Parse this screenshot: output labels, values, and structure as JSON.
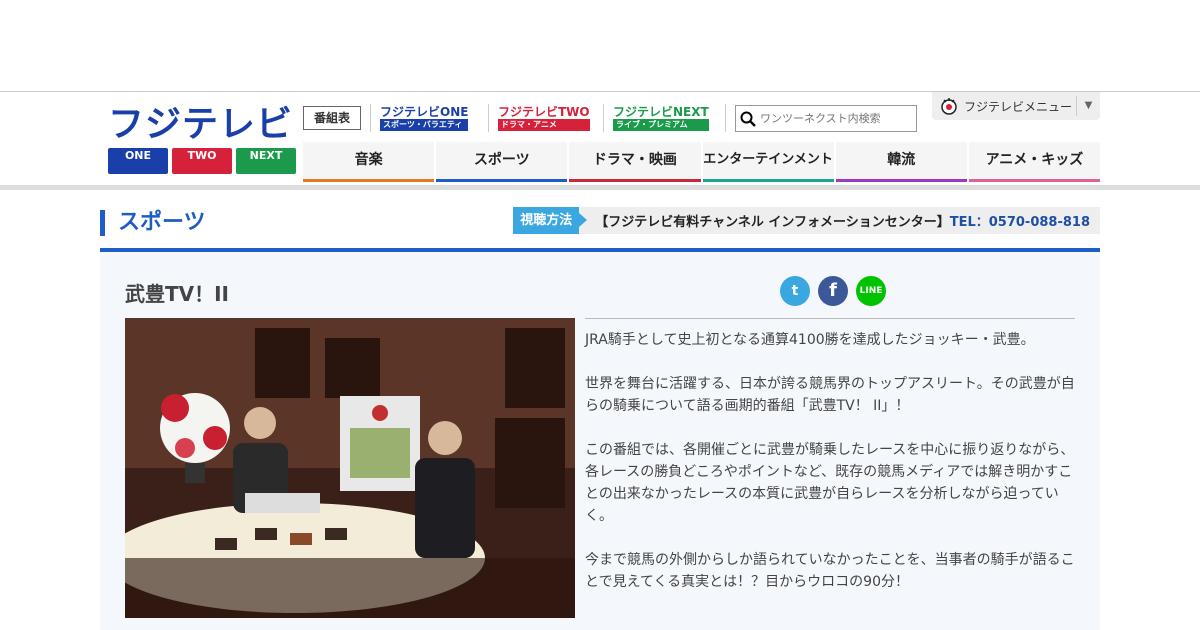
{
  "header": {
    "logo": {
      "main": "フジテレビ",
      "one": "ONE",
      "two": "TWO",
      "next": "NEXT"
    },
    "tv_guide": "番組表",
    "channels": [
      {
        "name": "フジテレビONE",
        "sub": "スポーツ・バラエティ",
        "color": "#1a3fa8"
      },
      {
        "name": "フジテレビTWO",
        "sub": "ドラマ・アニメ",
        "color": "#d6213a"
      },
      {
        "name": "フジテレビNEXT",
        "sub": "ライブ・プレミアム",
        "color": "#1a9a4a"
      }
    ],
    "search_placeholder": "ワンツーネクスト内検索",
    "fuji_menu": "フジテレビメニュー"
  },
  "nav": [
    {
      "label": "音楽",
      "color": "#e07a2a"
    },
    {
      "label": "スポーツ",
      "color": "#1e5cc8"
    },
    {
      "label": "ドラマ・映画",
      "color": "#c8283c"
    },
    {
      "label": "エンターテインメント",
      "color": "#1aa58a"
    },
    {
      "label": "韓流",
      "color": "#9a3cc0"
    },
    {
      "label": "アニメ・キッズ",
      "color": "#e0609a"
    }
  ],
  "section": {
    "title": "スポーツ",
    "badge": "視聴方法",
    "info": "【フジテレビ有料チャンネル インフォメーションセンター】",
    "tel": "TEL：0570-088-818"
  },
  "program": {
    "title": "武豊TV！II",
    "description": [
      "JRA騎手として史上初となる通算4100勝を達成したジョッキー・武豊。",
      "世界を舞台に活躍する、日本が誇る競馬界のトップアスリート。その武豊が自らの騎乗について語る画期的番組「武豊TV！ II」！",
      "この番組では、各開催ごとに武豊が騎乗したレースを中心に振り返りながら、各レースの勝負どころやポイントなど、既存の競馬メディアでは解き明かすことの出来なかったレースの本質に武豊が自らレースを分析しながら迫っていく。",
      "今まで競馬の外側からしか語られていなかったことを、当事者の騎手が語ることで見えてくる真実とは！？目からウロコの90分！"
    ]
  },
  "share": [
    {
      "name": "twitter",
      "glyph": "t",
      "color": "#3ba7e0"
    },
    {
      "name": "facebook",
      "glyph": "f",
      "color": "#3b5998"
    },
    {
      "name": "line",
      "glyph": "LINE",
      "color": "#00c300"
    }
  ]
}
